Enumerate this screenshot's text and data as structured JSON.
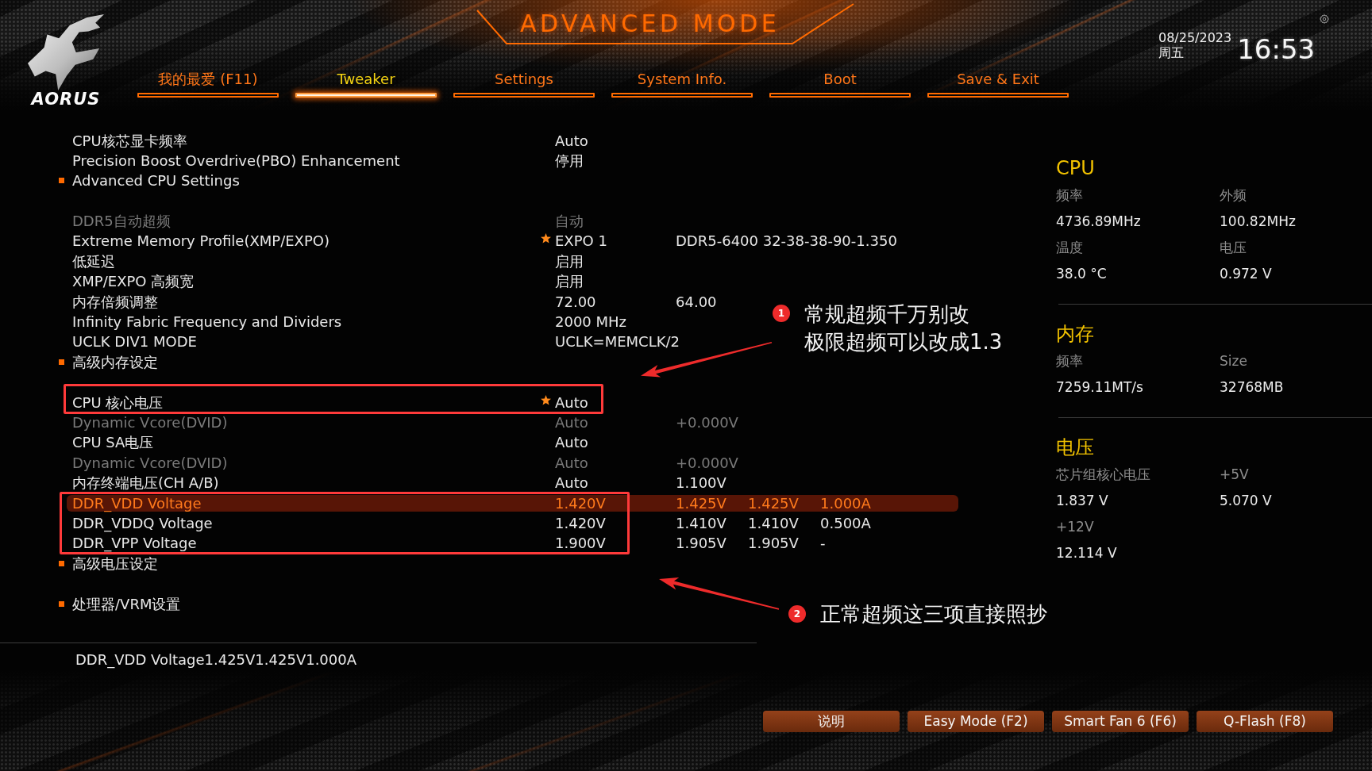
{
  "logo": {
    "text": "AORUS"
  },
  "mode_title": "ADVANCED MODE",
  "tabs": [
    {
      "label": "我的最爱 (F11)",
      "selected": false
    },
    {
      "label": "Tweaker",
      "selected": true
    },
    {
      "label": "Settings",
      "selected": false
    },
    {
      "label": "System Info.",
      "selected": false
    },
    {
      "label": "Boot",
      "selected": false
    },
    {
      "label": "Save & Exit",
      "selected": false
    }
  ],
  "clock": {
    "date": "08/25/2023",
    "weekday": "周五",
    "time": "16:53"
  },
  "setting_groups": [
    {
      "rows": [
        {
          "kind": "setting",
          "label": "CPU核芯显卡频率",
          "values": [
            "Auto"
          ],
          "selected": false,
          "disabled": false,
          "modified": false
        },
        {
          "kind": "setting",
          "label": "Precision Boost Overdrive(PBO) Enhancement",
          "values": [
            "停用"
          ],
          "selected": false,
          "disabled": false,
          "modified": false
        },
        {
          "kind": "submenu",
          "label": "Advanced CPU Settings",
          "selected": false,
          "disabled": false,
          "modified": false
        }
      ]
    },
    {
      "rows": [
        {
          "kind": "setting",
          "label": "DDR5自动超频",
          "values": [
            "自动"
          ],
          "selected": false,
          "disabled": true,
          "modified": false
        },
        {
          "kind": "setting",
          "label": "Extreme Memory Profile(XMP/EXPO)",
          "values": [
            "EXPO 1",
            "DDR5-6400 32-38-38-90-1.350"
          ],
          "selected": false,
          "disabled": false,
          "modified": true
        },
        {
          "kind": "setting",
          "label": "低延迟",
          "values": [
            "启用"
          ],
          "selected": false,
          "disabled": false,
          "modified": false
        },
        {
          "kind": "setting",
          "label": "XMP/EXPO 高频宽",
          "values": [
            "启用"
          ],
          "selected": false,
          "disabled": false,
          "modified": false
        },
        {
          "kind": "setting",
          "label": "内存倍频调整",
          "values": [
            "72.00",
            "64.00"
          ],
          "selected": false,
          "disabled": false,
          "modified": false
        },
        {
          "kind": "setting",
          "label": "Infinity Fabric Frequency and Dividers",
          "values": [
            "2000 MHz"
          ],
          "selected": false,
          "disabled": false,
          "modified": false
        },
        {
          "kind": "setting",
          "label": "UCLK DIV1 MODE",
          "values": [
            "UCLK=MEMCLK/2"
          ],
          "selected": false,
          "disabled": false,
          "modified": false
        },
        {
          "kind": "submenu",
          "label": "高级内存设定",
          "selected": false,
          "disabled": false,
          "modified": false
        }
      ]
    },
    {
      "rows": [
        {
          "kind": "setting",
          "label": "CPU 核心电压",
          "values": [
            "Auto"
          ],
          "selected": false,
          "disabled": false,
          "modified": true
        },
        {
          "kind": "setting",
          "label": "Dynamic Vcore(DVID)",
          "values": [
            "Auto",
            "+0.000V"
          ],
          "selected": false,
          "disabled": true,
          "modified": false
        },
        {
          "kind": "setting",
          "label": "CPU SA电压",
          "values": [
            "Auto"
          ],
          "selected": false,
          "disabled": false,
          "modified": false
        },
        {
          "kind": "setting",
          "label": "Dynamic Vcore(DVID)",
          "values": [
            "Auto",
            "+0.000V"
          ],
          "selected": false,
          "disabled": true,
          "modified": false
        },
        {
          "kind": "setting",
          "label": "内存终端电压(CH A/B)",
          "values": [
            "Auto",
            "1.100V"
          ],
          "selected": false,
          "disabled": false,
          "modified": false
        },
        {
          "kind": "setting",
          "label": "DDR_VDD Voltage",
          "values": [
            "1.420V",
            "1.425V",
            "1.425V",
            "1.000A"
          ],
          "selected": true,
          "disabled": false,
          "modified": false
        },
        {
          "kind": "setting",
          "label": "DDR_VDDQ Voltage",
          "values": [
            "1.420V",
            "1.410V",
            "1.410V",
            "0.500A"
          ],
          "selected": false,
          "disabled": false,
          "modified": false
        },
        {
          "kind": "setting",
          "label": "DDR_VPP Voltage",
          "values": [
            "1.900V",
            "1.905V",
            "1.905V",
            "-"
          ],
          "selected": false,
          "disabled": false,
          "modified": false
        },
        {
          "kind": "submenu",
          "label": "高级电压设定",
          "selected": false,
          "disabled": false,
          "modified": false
        }
      ]
    },
    {
      "rows": [
        {
          "kind": "submenu",
          "label": "处理器/VRM设置",
          "selected": false,
          "disabled": false,
          "modified": false
        }
      ]
    }
  ],
  "help_text": "DDR_VDD Voltage1.425V1.425V1.000A",
  "info_panel": {
    "sections": [
      {
        "title": "CPU",
        "items": [
          {
            "label": "频率",
            "value": "4736.89MHz"
          },
          {
            "label": "外频",
            "value": "100.82MHz"
          },
          {
            "label": "温度",
            "value": "38.0 °C"
          },
          {
            "label": "电压",
            "value": "0.972 V"
          }
        ]
      },
      {
        "title": "内存",
        "items": [
          {
            "label": "频率",
            "value": "7259.11MT/s"
          },
          {
            "label": "Size",
            "value": "32768MB"
          }
        ]
      },
      {
        "title": "电压",
        "items": [
          {
            "label": "芯片组核心电压",
            "value": "1.837 V"
          },
          {
            "label": "+5V",
            "value": "5.070 V"
          },
          {
            "label": "+12V",
            "value": "12.114 V"
          }
        ]
      }
    ]
  },
  "buttons": [
    {
      "label": "说明"
    },
    {
      "label": "Easy Mode (F2)"
    },
    {
      "label": "Smart Fan 6 (F6)"
    },
    {
      "label": "Q-Flash (F8)"
    }
  ],
  "annotations": [
    {
      "number": "1",
      "lines": [
        "常规超频千万别改",
        "极限超频可以改成1.3"
      ]
    },
    {
      "number": "2",
      "lines": [
        "正常超频这三项直接照抄"
      ]
    }
  ]
}
